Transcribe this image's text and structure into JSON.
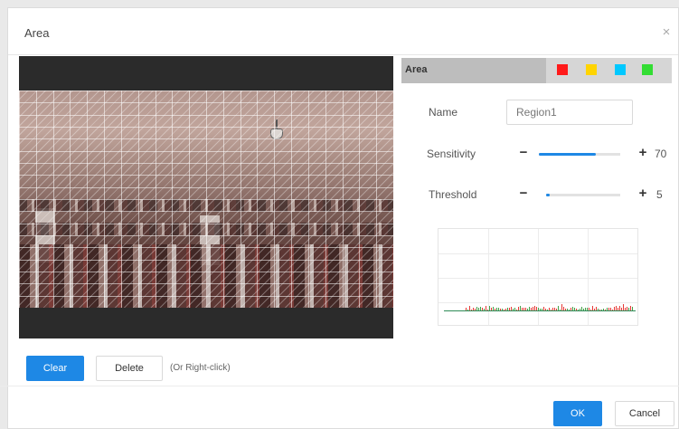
{
  "dialog": {
    "title": "Area",
    "close_glyph": "×"
  },
  "area": {
    "header_label": "Area",
    "swatches": [
      {
        "color": "#ff1a1a",
        "name": "red"
      },
      {
        "color": "#ffd400",
        "name": "yellow"
      },
      {
        "color": "#00c8ff",
        "name": "cyan"
      },
      {
        "color": "#33dd33",
        "name": "green"
      }
    ]
  },
  "settings": {
    "name_label": "Name",
    "name_value": "Region1",
    "sensitivity_label": "Sensitivity",
    "sensitivity_value": "70",
    "sensitivity_fraction": 0.7,
    "threshold_label": "Threshold",
    "threshold_value": "5",
    "threshold_fraction": 0.05,
    "minus_glyph": "−",
    "plus_glyph": "+"
  },
  "actions": {
    "clear_label": "Clear",
    "delete_label": "Delete",
    "hint": "(Or Right-click)"
  },
  "footer": {
    "ok_label": "OK",
    "cancel_label": "Cancel"
  },
  "colors": {
    "accent": "#1e88e5"
  }
}
